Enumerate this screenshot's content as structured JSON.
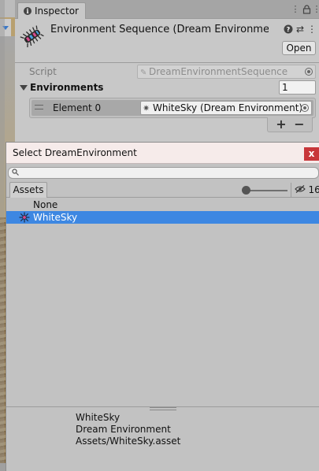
{
  "inspector": {
    "tab_label": "Inspector",
    "object_title": "Environment Sequence (Dream Environment Sequence)",
    "open_label": "Open",
    "script": {
      "label": "Script",
      "value": "DreamEnvironmentSequence"
    },
    "environments": {
      "label": "Environments",
      "count": "1",
      "elements": [
        {
          "label": "Element 0",
          "value": "WhiteSky (Dream Environment)"
        }
      ]
    },
    "add_label": "+",
    "remove_label": "−"
  },
  "select_window": {
    "title": "Select DreamEnvironment",
    "close_label": "x",
    "search": {
      "value": "",
      "placeholder": ""
    },
    "tabs": [
      "Assets"
    ],
    "hidden_count": "16",
    "items": [
      {
        "label": "None",
        "selected": false
      },
      {
        "label": "WhiteSky",
        "selected": true
      }
    ],
    "info": {
      "name": "WhiteSky",
      "type": "Dream Environment",
      "path": "Assets/WhiteSky.asset"
    }
  },
  "colors": {
    "selection": "#3d87e2",
    "close_button": "#c8363a",
    "title_bar": "#f6ebea",
    "panel_bg": "#c2c2c2"
  },
  "icons": [
    "info-icon",
    "lock-icon",
    "menu-icon",
    "help-icon",
    "presets-icon",
    "more-icon",
    "sun-icon",
    "eye-slash-icon",
    "search-icon"
  ]
}
